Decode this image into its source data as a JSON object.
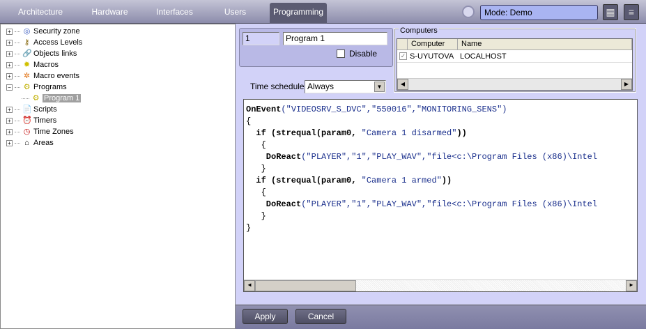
{
  "tabs": [
    "Architecture",
    "Hardware",
    "Interfaces",
    "Users",
    "Programming"
  ],
  "mode": "Mode: Demo",
  "tree": [
    "Security zone",
    "Access Levels",
    "Objects links",
    "Macros",
    "Macro events",
    "Programs",
    "Program 1",
    "Scripts",
    "Timers",
    "Time Zones",
    "Areas"
  ],
  "program": {
    "id": "1",
    "name": "Program 1",
    "disable_label": "Disable",
    "time_schedule_label": "Time schedule",
    "time_schedule": "Always"
  },
  "computers": {
    "title": "Computers",
    "headers": [
      "Computer",
      "Name"
    ],
    "rows": [
      {
        "computer": "S-UYUTOVA",
        "name": "LOCALHOST"
      }
    ]
  },
  "code": {
    "l1a": "OnEvent",
    "l1b": "(\"VIDEOSRV_S_DVC\",\"550016\",\"MONITORING_SENS\")",
    "l2": "{",
    "l3a": "  if (strequal(param0, ",
    "l3b": "\"Camera 1 disarmed\"",
    "l3c": "))",
    "l4": "   {",
    "l5a": "    DoReact",
    "l5b": "(\"PLAYER\",\"1\",\"PLAY_WAV\",\"file<c:\\Program Files (x86)\\Intel",
    "l6": "   }",
    "l7a": "  if (strequal(param0, ",
    "l7b": "\"Camera 1 armed\"",
    "l7c": "))",
    "l8": "   {",
    "l9a": "    DoReact",
    "l9b": "(\"PLAYER\",\"1\",\"PLAY_WAV\",\"file<c:\\Program Files (x86)\\Intel",
    "l10": "   }",
    "l11": "}"
  },
  "buttons": {
    "apply": "Apply",
    "cancel": "Cancel"
  }
}
